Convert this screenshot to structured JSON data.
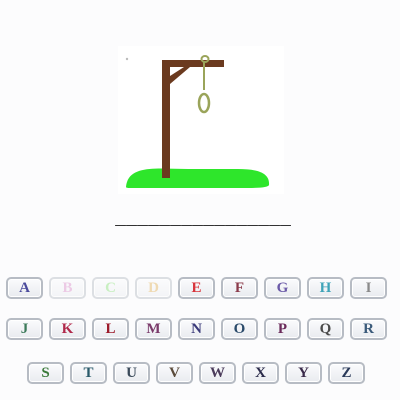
{
  "game": {
    "word_blanks": [
      "_",
      "_",
      "_",
      "_",
      "_",
      "_",
      "_",
      "_",
      "_",
      "_",
      "_",
      "_",
      "_",
      "_",
      "_",
      "_"
    ]
  },
  "colors": {
    "gallows_wood": "#6b3a1f",
    "rope": "#9aa45a",
    "grass": "#2ee62b",
    "key_border": "#b7bcc4"
  },
  "keyboard": {
    "rows": [
      [
        {
          "letter": "A",
          "color": "#4a4a9c",
          "used": false
        },
        {
          "letter": "B",
          "color": "#d98fc9",
          "used": true
        },
        {
          "letter": "C",
          "color": "#8be07a",
          "used": true
        },
        {
          "letter": "D",
          "color": "#e0b25a",
          "used": true
        },
        {
          "letter": "E",
          "color": "#d8343b",
          "used": false
        },
        {
          "letter": "F",
          "color": "#8a3a4a",
          "used": false
        },
        {
          "letter": "G",
          "color": "#6b5aa8",
          "used": false
        },
        {
          "letter": "H",
          "color": "#3ea3b8",
          "used": false
        },
        {
          "letter": "I",
          "color": "#8a8a8a",
          "used": false
        }
      ],
      [
        {
          "letter": "J",
          "color": "#3c7a5a",
          "used": false
        },
        {
          "letter": "K",
          "color": "#b0284a",
          "used": false
        },
        {
          "letter": "L",
          "color": "#9c1a2a",
          "used": false
        },
        {
          "letter": "M",
          "color": "#7a3a6a",
          "used": false
        },
        {
          "letter": "N",
          "color": "#3a3a7a",
          "used": false
        },
        {
          "letter": "O",
          "color": "#2a4a6a",
          "used": false
        },
        {
          "letter": "P",
          "color": "#6a2a5a",
          "used": false
        },
        {
          "letter": "Q",
          "color": "#4a4a4a",
          "used": false
        },
        {
          "letter": "R",
          "color": "#3a5a7a",
          "used": false
        }
      ],
      [
        {
          "letter": "S",
          "color": "#3a7a3a",
          "used": false
        },
        {
          "letter": "T",
          "color": "#2a5a6a",
          "used": false
        },
        {
          "letter": "U",
          "color": "#3a4a5a",
          "used": false
        },
        {
          "letter": "V",
          "color": "#5a4a3a",
          "used": false
        },
        {
          "letter": "W",
          "color": "#4a3a5a",
          "used": false
        },
        {
          "letter": "X",
          "color": "#2a2a4a",
          "used": false
        },
        {
          "letter": "Y",
          "color": "#3a2a4a",
          "used": false
        },
        {
          "letter": "Z",
          "color": "#2a3a5a",
          "used": false
        }
      ]
    ]
  }
}
